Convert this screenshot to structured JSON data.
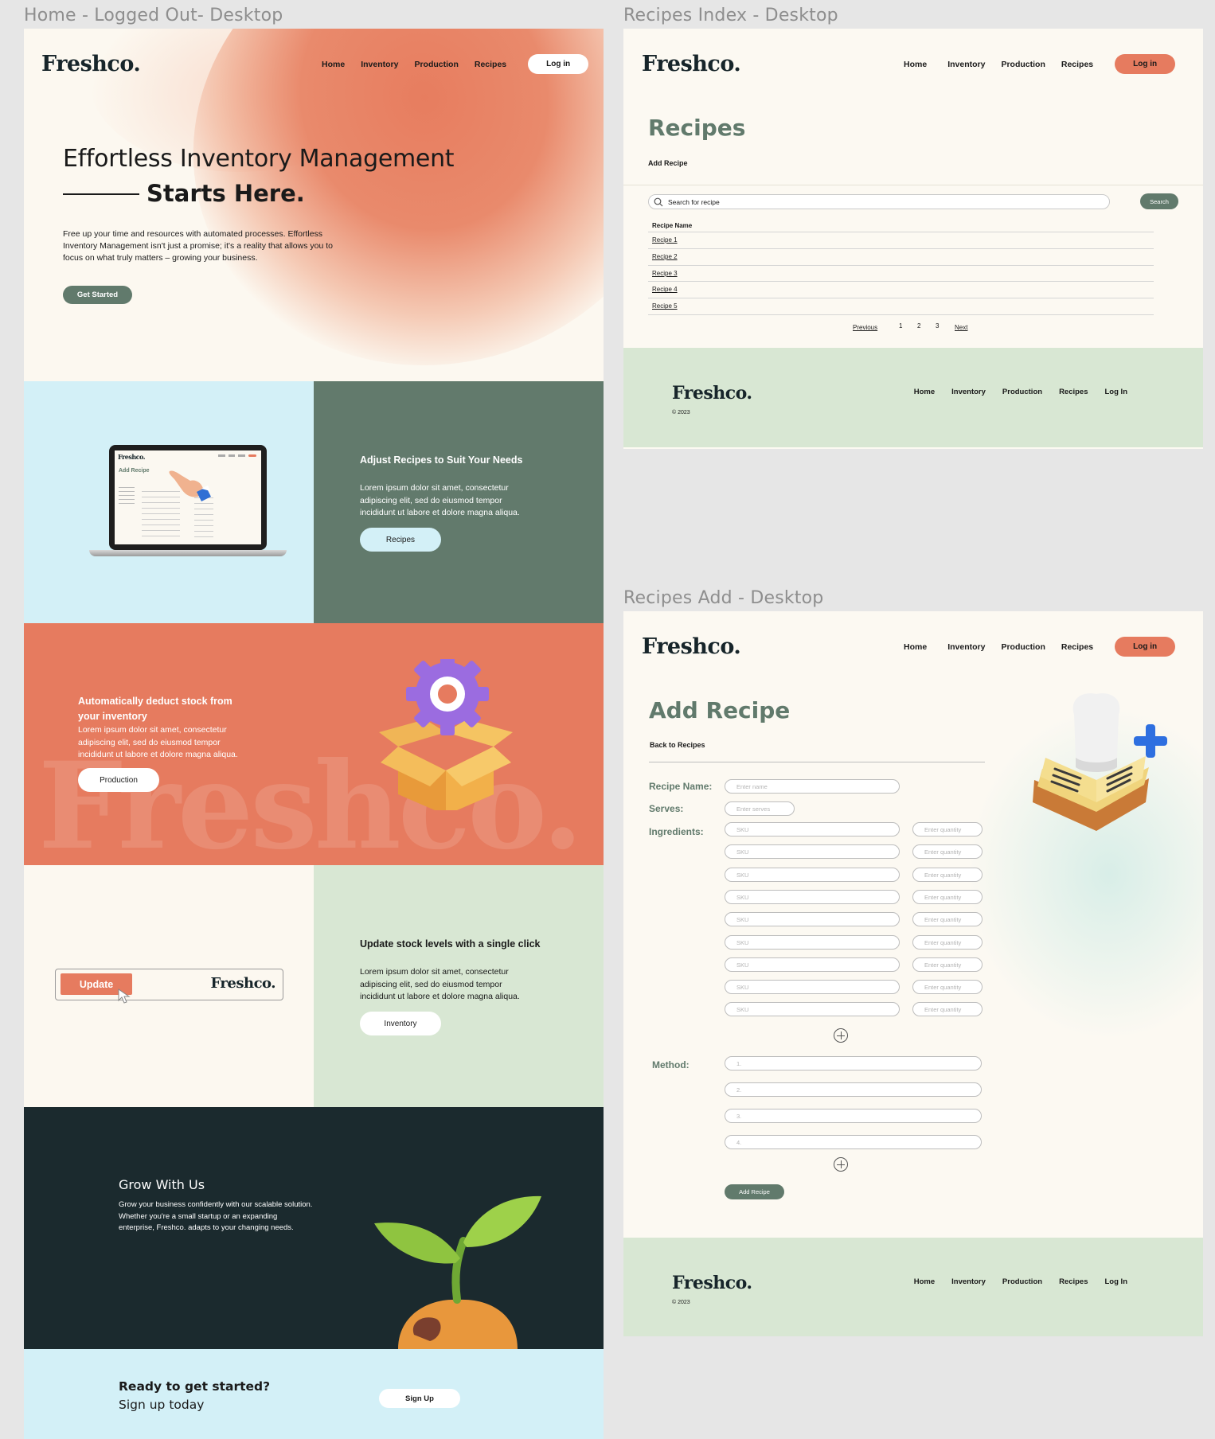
{
  "frames": {
    "home_label": "Home - Logged Out- Desktop",
    "index_label": "Recipes Index - Desktop",
    "add_label": "Recipes Add - Desktop"
  },
  "brand": {
    "logo": "Freshco."
  },
  "nav": {
    "home": "Home",
    "inventory": "Inventory",
    "production": "Production",
    "recipes": "Recipes",
    "login": "Log in"
  },
  "home": {
    "hero": {
      "title": "Effortless Inventory Management",
      "title_strong": "Starts Here.",
      "body": "Free up your time and resources with automated processes. Effortless Inventory Management isn't just a promise; it's a reality that allows you to focus on what truly matters – growing your business.",
      "cta": "Get Started"
    },
    "recipes_section": {
      "title": "Adjust Recipes to Suit Your Needs",
      "body": "Lorem ipsum dolor sit amet, consectetur adipiscing elit, sed do eiusmod tempor incididunt ut labore et dolore magna aliqua.",
      "button": "Recipes",
      "screen_title": "Add Recipe"
    },
    "production_section": {
      "title": "Automatically deduct stock from your inventory",
      "body": "Lorem ipsum dolor sit amet, consectetur adipiscing elit, sed do eiusmod tempor incididunt ut labore et dolore magna aliqua.",
      "button": "Production",
      "watermark": "Freshco."
    },
    "inventory_section": {
      "title": "Update stock levels with a single click",
      "body": "Lorem ipsum dolor sit amet, consectetur adipiscing elit, sed do eiusmod tempor incididunt ut labore et dolore magna aliqua.",
      "button": "Inventory",
      "update_label": "Update"
    },
    "grow_section": {
      "title": "Grow With Us",
      "body": "Grow your business confidently with our scalable solution. Whether you're a small startup or an expanding enterprise, Freshco. adapts to your changing needs."
    },
    "signup_section": {
      "title": "Ready to get started?",
      "subtitle": "Sign up today",
      "button": "Sign Up"
    }
  },
  "index": {
    "title": "Recipes",
    "add_link": "Add Recipe",
    "search_placeholder": "Search for recipe",
    "search_button": "Search",
    "table_header": "Recipe Name",
    "rows": [
      "Recipe 1",
      "Recipe 2",
      "Recipe 3",
      "Recipe 4",
      "Recipe 5"
    ],
    "pager": {
      "previous": "Previous",
      "p1": "1",
      "p2": "2",
      "p3": "3",
      "next": "Next"
    }
  },
  "footer": {
    "copyright": "© 2023",
    "login": "Log In"
  },
  "add": {
    "title": "Add Recipe",
    "back_link": "Back to Recipes",
    "labels": {
      "name": "Recipe Name:",
      "serves": "Serves:",
      "ingredients": "Ingredients:",
      "method": "Method:"
    },
    "placeholders": {
      "name": "Enter name",
      "serves": "Enter serves",
      "sku": "SKU",
      "qty": "Enter quantity"
    },
    "method_steps": [
      "1.",
      "2.",
      "3.",
      "4."
    ],
    "submit": "Add Recipe"
  },
  "colors": {
    "accent": "#e67b5f",
    "sage": "#617a6c",
    "mint": "#d8e7d3",
    "sky": "#d3f0f7",
    "dark": "#1b2a2e",
    "cream": "#fcf8f0"
  }
}
